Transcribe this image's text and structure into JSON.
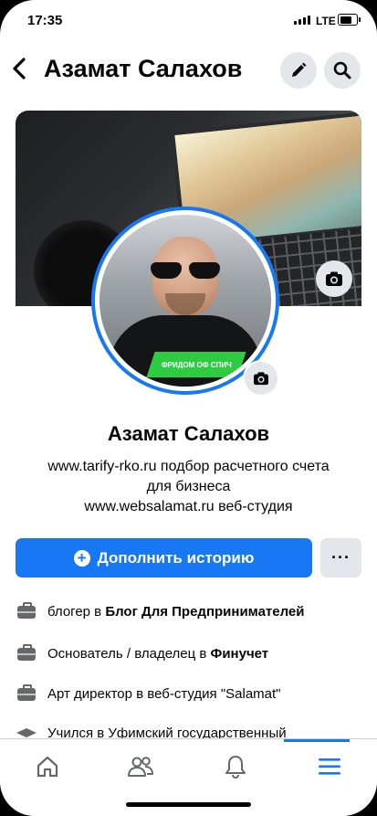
{
  "status_bar": {
    "time": "17:35",
    "network": "LTE"
  },
  "header": {
    "back_icon": "chevron-left-icon",
    "title": "Азамат Салахов",
    "edit_icon": "pencil-icon",
    "search_icon": "search-icon"
  },
  "profile": {
    "avatar_shirt_text": "ФРИДОМ ОФ СПИЧ",
    "name": "Азамат Салахов",
    "bio_lines": [
      "www.tarify-rko.ru подбор расчетного счета",
      "для бизнеса",
      "www.websalamat.ru веб-студия"
    ]
  },
  "actions": {
    "add_story_label": "Дополнить историю",
    "more_label": "···"
  },
  "info": [
    {
      "icon": "briefcase-icon",
      "prefix": "блогер в ",
      "bold": "Блог Для Предпринимателей",
      "suffix": ""
    },
    {
      "icon": "briefcase-icon",
      "prefix": "Основатель / владелец в ",
      "bold": "Финучет",
      "suffix": ""
    },
    {
      "icon": "briefcase-icon",
      "prefix": "Арт директор в веб-студия \"Salamat\"",
      "bold": "",
      "suffix": ""
    },
    {
      "icon": "graduation-cap-icon",
      "prefix": "Учился в Уфимский государственный",
      "bold": "",
      "suffix": ""
    }
  ],
  "colors": {
    "accent": "#1877f2",
    "icon_gray": "#65676b",
    "button_gray": "#e4e6eb"
  }
}
